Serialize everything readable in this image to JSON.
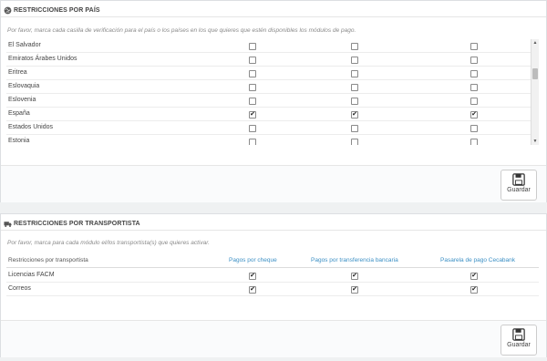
{
  "countries_panel": {
    "title": "Restricciones por país",
    "help": "Por favor, marca cada casilla de verificación para el país o los países en los que quieres que estén disponibles los módulos de pago.",
    "rows": [
      {
        "name": "El Salvador",
        "checks": [
          false,
          false,
          false
        ]
      },
      {
        "name": "Emiratos Árabes Unidos",
        "checks": [
          false,
          false,
          false
        ]
      },
      {
        "name": "Eritrea",
        "checks": [
          false,
          false,
          false
        ]
      },
      {
        "name": "Eslovaquia",
        "checks": [
          false,
          false,
          false
        ]
      },
      {
        "name": "Eslovenia",
        "checks": [
          false,
          false,
          false
        ]
      },
      {
        "name": "España",
        "checks": [
          true,
          true,
          true
        ]
      },
      {
        "name": "Estados Unidos",
        "checks": [
          false,
          false,
          false
        ]
      },
      {
        "name": "Estonia",
        "checks": [
          false,
          false,
          false
        ]
      },
      {
        "name": "",
        "checks": [
          false,
          false,
          false
        ]
      }
    ],
    "save_label": "Guardar"
  },
  "carriers_panel": {
    "title": "Restricciones por transportista",
    "help": "Por favor, marca para cada módulo el/los transportista(s) que quieres activar.",
    "col_header": "Restricciones por transportista",
    "modules": [
      "Pagos por cheque",
      "Pagos por transferencia bancaria",
      "Pasarela de pago Cecabank"
    ],
    "rows": [
      {
        "name": "Licencias FACM",
        "checks": [
          true,
          true,
          true
        ]
      },
      {
        "name": "Correos",
        "checks": [
          true,
          true,
          true
        ]
      }
    ],
    "save_label": "Guardar"
  },
  "icons": {
    "globe": "globe-icon",
    "truck": "truck-icon",
    "save": "floppy-disk-icon",
    "check": "✔"
  }
}
